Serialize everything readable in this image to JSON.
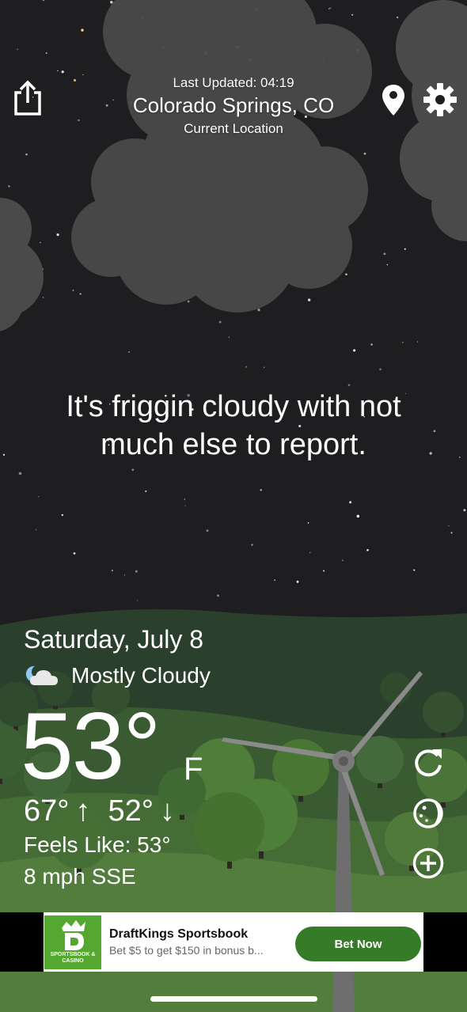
{
  "header": {
    "last_updated": "Last Updated: 04:19",
    "city": "Colorado Springs, CO",
    "subtitle": "Current Location"
  },
  "icons": {
    "share": "share-icon",
    "location": "location-pin-icon",
    "settings": "gear-icon",
    "refresh": "refresh-icon",
    "moon": "moon-icon",
    "add": "plus-circle-icon",
    "condition": "partly-cloudy-night-icon"
  },
  "message": "It's friggin cloudy with not much else to report.",
  "weather": {
    "date": "Saturday, July 8",
    "condition": "Mostly Cloudy",
    "temperature": "53°",
    "unit": "F",
    "high": "67°",
    "low": "52°",
    "high_arrow": "↑",
    "low_arrow": "↓",
    "feels_like": "Feels Like: 53°",
    "wind": "8 mph SSE"
  },
  "ad": {
    "title": "DraftKings Sportsbook",
    "description": "Bet $5 to get $150 in bonus b...",
    "cta": "Bet Now",
    "logo_text": "SPORTSBOOK & CASINO"
  },
  "colors": {
    "sky": "#1e1e20",
    "cloud": "#4a4a4a",
    "hill_dark": "#2b3f2d",
    "hill_mid": "#3f5f33",
    "hill_light": "#4f7a3a",
    "ad_green": "#367b27",
    "logo_green": "#54a82f"
  }
}
